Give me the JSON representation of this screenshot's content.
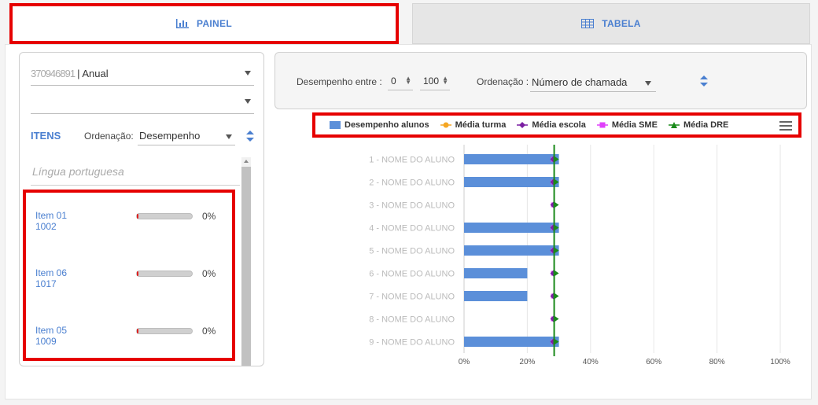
{
  "tabs": {
    "painel": "PAINEL",
    "tabela": "TABELA"
  },
  "left": {
    "period_select": "| Anual",
    "period_blurred": "370946891",
    "second_select": "",
    "itens_label": "ITENS",
    "ordenacao_label": "Ordenação:",
    "ordenacao_value": "Desempenho",
    "search_placeholder": "Língua portuguesa",
    "items": [
      {
        "name": "Item 01",
        "code": "1002",
        "pct_label": "0%",
        "value": 0
      },
      {
        "name": "Item 06",
        "code": "1017",
        "pct_label": "0%",
        "value": 0
      },
      {
        "name": "Item 05",
        "code": "1009",
        "pct_label": "0%",
        "value": 0
      }
    ]
  },
  "filter": {
    "desempenho_label": "Desempenho entre :",
    "min_value": "0",
    "max_value": "100",
    "ordenacao_label": "Ordenação :",
    "ordenacao_value": "Número de chamada"
  },
  "legend": {
    "desempenho_alunos": "Desempenho alunos",
    "media_turma": "Média turma",
    "media_escola": "Média escola",
    "media_sme": "Média SME",
    "media_dre": "Média DRE"
  },
  "colors": {
    "accent": "#4a7fd0",
    "bar": "#5b8fd9",
    "highlight": "#e60000",
    "media_turma": "#f5a623",
    "media_escola": "#7b1fa2",
    "media_sme": "#e040fb",
    "media_dre": "#1b8a1b"
  },
  "chart_data": {
    "type": "bar",
    "orientation": "horizontal",
    "categories": [
      "1 - NOME DO ALUNO",
      "2 - NOME DO ALUNO",
      "3 - NOME DO ALUNO",
      "4 - NOME DO ALUNO",
      "5 - NOME DO ALUNO",
      "6 - NOME DO ALUNO",
      "7 - NOME DO ALUNO",
      "8 - NOME DO ALUNO",
      "9 - NOME DO ALUNO"
    ],
    "series": [
      {
        "name": "Desempenho alunos",
        "values": [
          30,
          30,
          0,
          30,
          30,
          20,
          20,
          0,
          30
        ]
      },
      {
        "name": "Média turma",
        "values": [
          28.5,
          28.5,
          28.5,
          28.5,
          28.5,
          28.5,
          28.5,
          28.5,
          28.5
        ]
      },
      {
        "name": "Média escola",
        "values": [
          28.5,
          28.5,
          28.5,
          28.5,
          28.5,
          28.5,
          28.5,
          28.5,
          28.5
        ]
      },
      {
        "name": "Média SME",
        "values": [
          28.5,
          28.5,
          28.5,
          28.5,
          28.5,
          28.5,
          28.5,
          28.5,
          28.5
        ]
      },
      {
        "name": "Média DRE",
        "values": [
          28.5,
          28.5,
          28.5,
          28.5,
          28.5,
          28.5,
          28.5,
          28.5,
          28.5
        ]
      }
    ],
    "x_ticks": [
      "0%",
      "20%",
      "40%",
      "60%",
      "80%",
      "100%"
    ],
    "xlim": [
      0,
      100
    ],
    "grid": true,
    "legend_position": "top"
  }
}
